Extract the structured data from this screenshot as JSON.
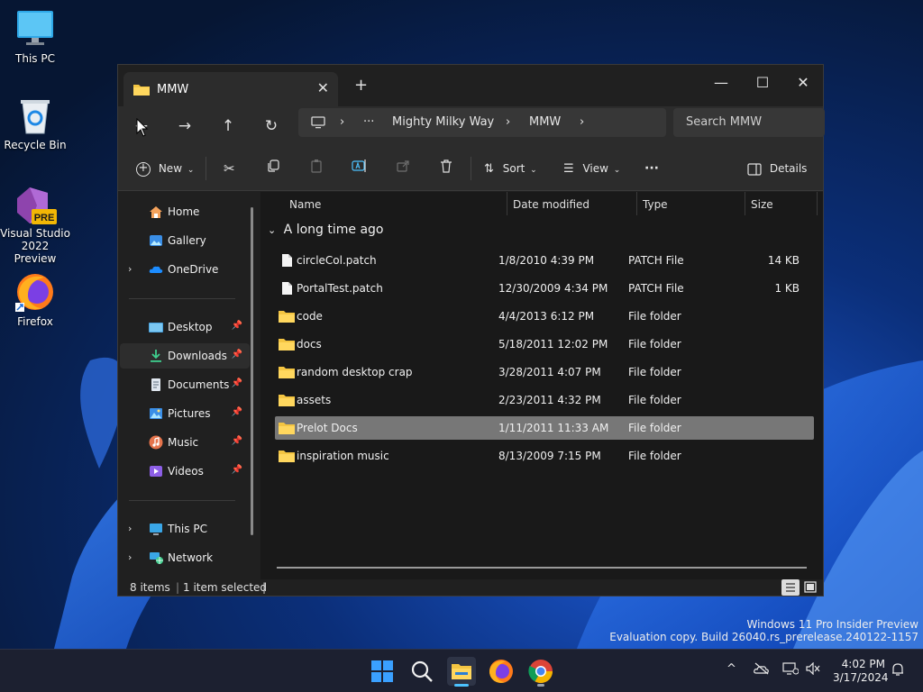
{
  "desktop": {
    "icons": [
      {
        "label": "This PC"
      },
      {
        "label": "Recycle Bin"
      },
      {
        "label": "Visual Studio 2022 Preview",
        "badge": "PRE"
      },
      {
        "label": "Firefox"
      }
    ],
    "watermark_line1": "Windows 11 Pro Insider Preview",
    "watermark_line2": "Evaluation copy. Build 26040.rs_prerelease.240122-1157"
  },
  "window": {
    "tab_title": "MMW",
    "close_tab_glyph": "✕",
    "new_tab_glyph": "+",
    "minimize_glyph": "—",
    "maximize_glyph": "☐",
    "close_glyph": "✕",
    "nav": {
      "back": "←",
      "forward": "→",
      "up": "↑",
      "refresh": "↻"
    },
    "address": {
      "more": "···",
      "crumbs": [
        "Mighty Milky Way",
        "MMW"
      ],
      "separator": "›"
    },
    "search_placeholder": "Search MMW",
    "commands": {
      "new_label": "New",
      "sort_label": "Sort",
      "view_label": "View",
      "more_label": "···",
      "details_label": "Details"
    },
    "sidebar": {
      "quick": [
        {
          "label": "Home"
        },
        {
          "label": "Gallery"
        },
        {
          "label": "OneDrive"
        }
      ],
      "pinned": [
        {
          "label": "Desktop"
        },
        {
          "label": "Downloads"
        },
        {
          "label": "Documents"
        },
        {
          "label": "Pictures"
        },
        {
          "label": "Music"
        },
        {
          "label": "Videos"
        }
      ],
      "devices": [
        {
          "label": "This PC"
        },
        {
          "label": "Network"
        }
      ]
    },
    "columns": {
      "name": "Name",
      "date": "Date modified",
      "type": "Type",
      "size": "Size"
    },
    "group_label": "A long time ago",
    "files": [
      {
        "name": "circleCol.patch",
        "date": "1/8/2010 4:39 PM",
        "type": "PATCH File",
        "size": "14 KB",
        "kind": "file"
      },
      {
        "name": "PortalTest.patch",
        "date": "12/30/2009 4:34 PM",
        "type": "PATCH File",
        "size": "1 KB",
        "kind": "file"
      },
      {
        "name": "code",
        "date": "4/4/2013 6:12 PM",
        "type": "File folder",
        "size": "",
        "kind": "folder"
      },
      {
        "name": "docs",
        "date": "5/18/2011 12:02 PM",
        "type": "File folder",
        "size": "",
        "kind": "folder"
      },
      {
        "name": "random desktop crap",
        "date": "3/28/2011 4:07 PM",
        "type": "File folder",
        "size": "",
        "kind": "folder"
      },
      {
        "name": "assets",
        "date": "2/23/2011 4:32 PM",
        "type": "File folder",
        "size": "",
        "kind": "folder"
      },
      {
        "name": "Prelot Docs",
        "date": "1/11/2011 11:33 AM",
        "type": "File folder",
        "size": "",
        "kind": "folder",
        "selected": true
      },
      {
        "name": "inspiration music",
        "date": "8/13/2009 7:15 PM",
        "type": "File folder",
        "size": "",
        "kind": "folder"
      }
    ],
    "status": {
      "count": "8 items",
      "selection": "1 item selected"
    }
  },
  "taskbar": {
    "time": "4:02 PM",
    "date": "3/17/2024",
    "tray_chevron": "^"
  },
  "colors": {
    "folder": "#f4c542",
    "accent": "#4cc2ff",
    "selection": "#777777"
  }
}
